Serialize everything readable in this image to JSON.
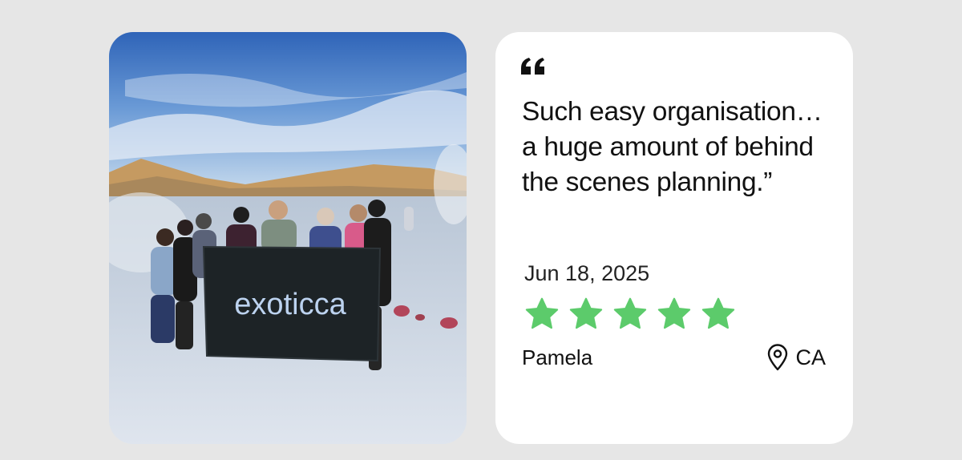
{
  "photo": {
    "banner_text": "exoticca"
  },
  "review": {
    "quote_icon": "quote-icon",
    "text": "Such easy organisation… a huge amount of behind the scenes planning.”",
    "date": "Jun 18, 2025",
    "rating": 5,
    "rating_max": 5,
    "star_color": "#5ccb6b",
    "reviewer_name": "Pamela",
    "location_icon": "location-pin-icon",
    "location": "CA"
  }
}
